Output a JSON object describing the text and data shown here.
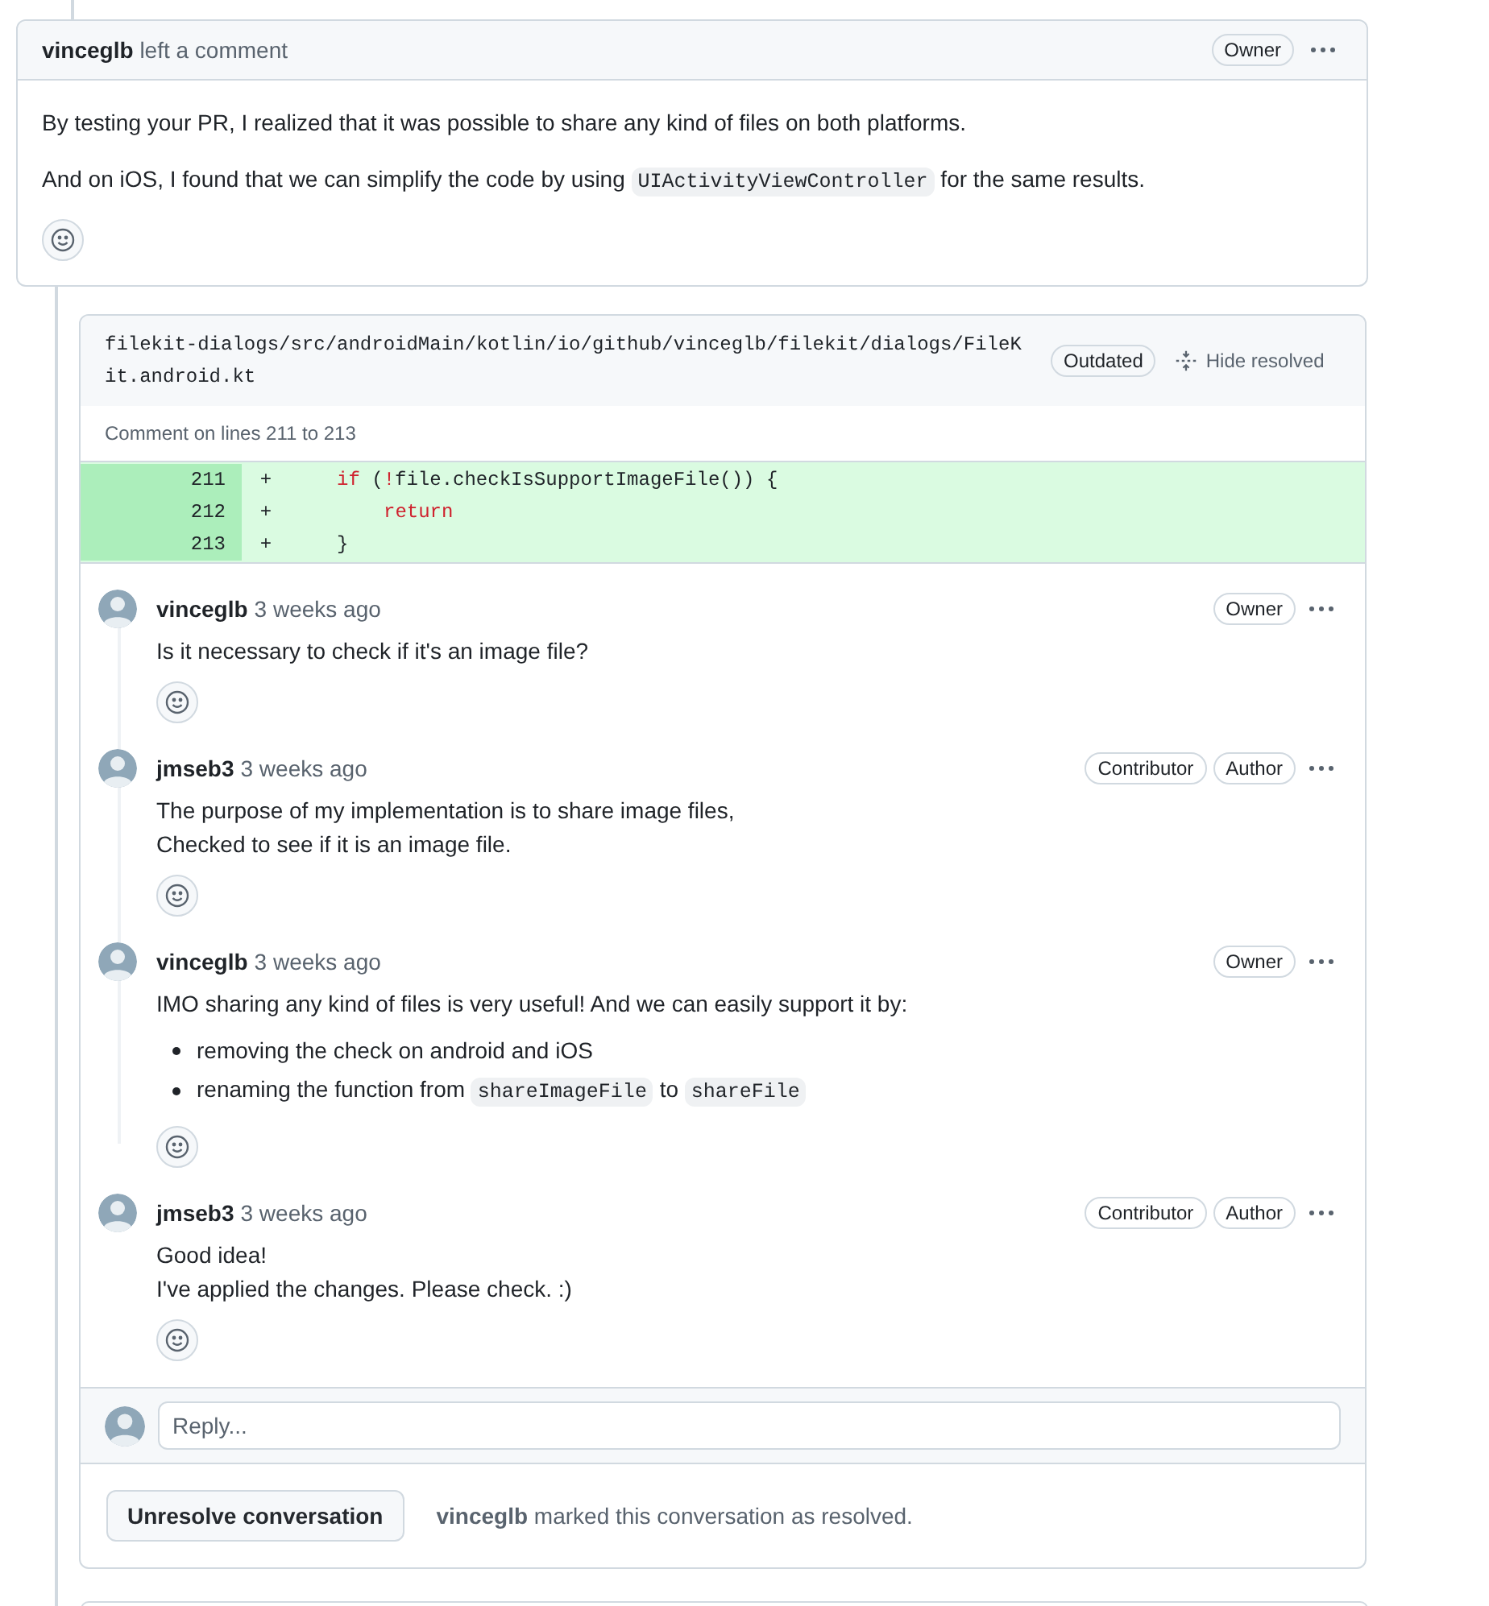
{
  "top_comment": {
    "author": "vinceglb",
    "action": "left a comment",
    "badges": [
      "Owner"
    ],
    "body": [
      {
        "kind": "paragraph",
        "lines": [
          [
            {
              "kind": "text",
              "text": "By testing your PR, I realized that it was possible to share any kind of files on both platforms."
            }
          ]
        ]
      },
      {
        "kind": "paragraph",
        "lines": [
          [
            {
              "kind": "text",
              "text": "And on iOS, I found that we can simplify the code by using "
            },
            {
              "kind": "code",
              "text": "UIActivityViewController"
            },
            {
              "kind": "text",
              "text": " for the same results."
            }
          ]
        ]
      }
    ]
  },
  "thread": {
    "file_path": "filekit-dialogs/src/androidMain/kotlin/io/github/vinceglb/filekit/dialogs/FileKit.android.kt",
    "status_badge": "Outdated",
    "hide_button": "Hide resolved",
    "lines_caption": "Comment on lines 211 to 213",
    "diff": [
      {
        "number": "211",
        "sign": "+",
        "kind": "outer",
        "tokens": [
          {
            "kind": "keyword",
            "text": "if"
          },
          {
            "kind": "plain",
            "text": " ("
          },
          {
            "kind": "keyword",
            "text": "!"
          },
          {
            "kind": "plain",
            "text": "file.checkIsSupportImageFile()) {"
          }
        ]
      },
      {
        "number": "212",
        "sign": "+",
        "kind": "inner",
        "tokens": [
          {
            "kind": "keyword",
            "text": "return"
          }
        ]
      },
      {
        "number": "213",
        "sign": "+",
        "kind": "outer",
        "tokens": [
          {
            "kind": "plain",
            "text": "}"
          }
        ]
      }
    ],
    "comments": [
      {
        "author": "vinceglb",
        "time": "3 weeks ago",
        "badges": [
          "Owner"
        ],
        "body": [
          {
            "kind": "paragraph",
            "lines": [
              [
                {
                  "kind": "text",
                  "text": "Is it necessary to check if it's an image file?"
                }
              ]
            ]
          }
        ]
      },
      {
        "author": "jmseb3",
        "time": "3 weeks ago",
        "badges": [
          "Contributor",
          "Author"
        ],
        "body": [
          {
            "kind": "paragraph",
            "lines": [
              [
                {
                  "kind": "text",
                  "text": "The purpose of my implementation is to share image files,"
                }
              ],
              [
                {
                  "kind": "text",
                  "text": "Checked to see if it is an image file."
                }
              ]
            ]
          }
        ]
      },
      {
        "author": "vinceglb",
        "time": "3 weeks ago",
        "badges": [
          "Owner"
        ],
        "body": [
          {
            "kind": "paragraph",
            "lines": [
              [
                {
                  "kind": "text",
                  "text": "IMO sharing any kind of files is very useful! And we can easily support it by:"
                }
              ]
            ]
          },
          {
            "kind": "list",
            "items": [
              [
                {
                  "kind": "text",
                  "text": "removing the check on android and iOS"
                }
              ],
              [
                {
                  "kind": "text",
                  "text": "renaming the function from "
                },
                {
                  "kind": "code",
                  "text": "shareImageFile"
                },
                {
                  "kind": "text",
                  "text": " to "
                },
                {
                  "kind": "code",
                  "text": "shareFile"
                }
              ]
            ]
          }
        ]
      },
      {
        "author": "jmseb3",
        "time": "3 weeks ago",
        "badges": [
          "Contributor",
          "Author"
        ],
        "body": [
          {
            "kind": "paragraph",
            "lines": [
              [
                {
                  "kind": "text",
                  "text": "Good idea!"
                }
              ],
              [
                {
                  "kind": "text",
                  "text": "I've applied the changes. Please check. :)"
                }
              ]
            ]
          }
        ]
      }
    ],
    "reply": {
      "placeholder": "Reply..."
    },
    "unresolve_button": "Unresolve conversation",
    "resolved_by": "vinceglb",
    "resolved_text": "marked this conversation as resolved."
  }
}
